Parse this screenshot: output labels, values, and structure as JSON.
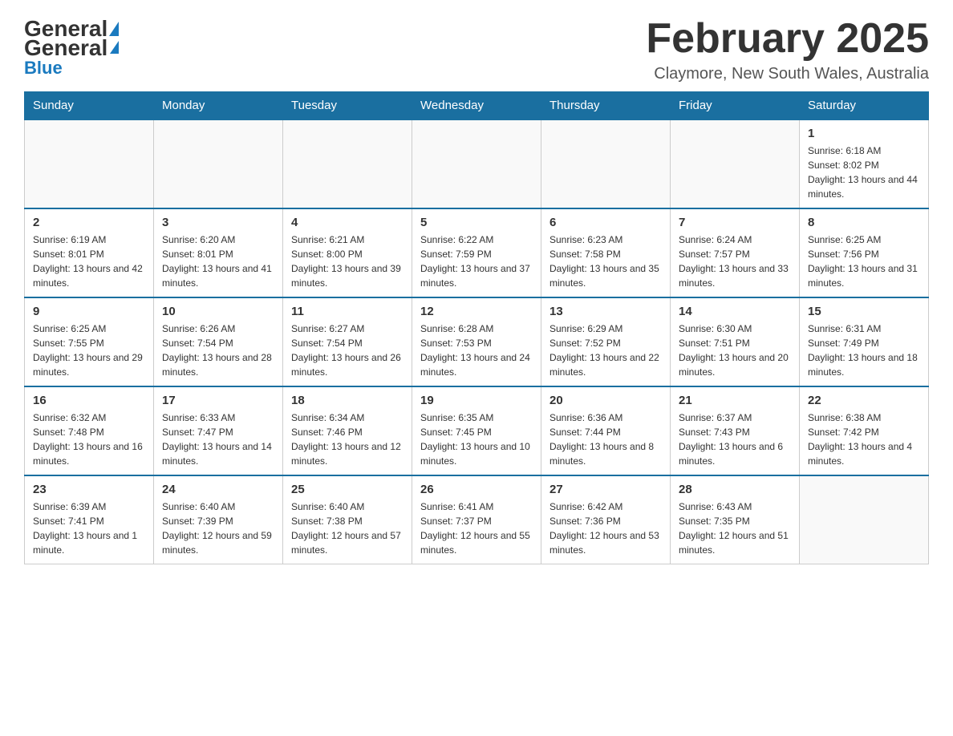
{
  "header": {
    "logo_general": "General",
    "logo_blue": "Blue",
    "month_title": "February 2025",
    "location": "Claymore, New South Wales, Australia"
  },
  "days_of_week": [
    "Sunday",
    "Monday",
    "Tuesday",
    "Wednesday",
    "Thursday",
    "Friday",
    "Saturday"
  ],
  "weeks": [
    [
      {
        "day": "",
        "info": ""
      },
      {
        "day": "",
        "info": ""
      },
      {
        "day": "",
        "info": ""
      },
      {
        "day": "",
        "info": ""
      },
      {
        "day": "",
        "info": ""
      },
      {
        "day": "",
        "info": ""
      },
      {
        "day": "1",
        "info": "Sunrise: 6:18 AM\nSunset: 8:02 PM\nDaylight: 13 hours and 44 minutes."
      }
    ],
    [
      {
        "day": "2",
        "info": "Sunrise: 6:19 AM\nSunset: 8:01 PM\nDaylight: 13 hours and 42 minutes."
      },
      {
        "day": "3",
        "info": "Sunrise: 6:20 AM\nSunset: 8:01 PM\nDaylight: 13 hours and 41 minutes."
      },
      {
        "day": "4",
        "info": "Sunrise: 6:21 AM\nSunset: 8:00 PM\nDaylight: 13 hours and 39 minutes."
      },
      {
        "day": "5",
        "info": "Sunrise: 6:22 AM\nSunset: 7:59 PM\nDaylight: 13 hours and 37 minutes."
      },
      {
        "day": "6",
        "info": "Sunrise: 6:23 AM\nSunset: 7:58 PM\nDaylight: 13 hours and 35 minutes."
      },
      {
        "day": "7",
        "info": "Sunrise: 6:24 AM\nSunset: 7:57 PM\nDaylight: 13 hours and 33 minutes."
      },
      {
        "day": "8",
        "info": "Sunrise: 6:25 AM\nSunset: 7:56 PM\nDaylight: 13 hours and 31 minutes."
      }
    ],
    [
      {
        "day": "9",
        "info": "Sunrise: 6:25 AM\nSunset: 7:55 PM\nDaylight: 13 hours and 29 minutes."
      },
      {
        "day": "10",
        "info": "Sunrise: 6:26 AM\nSunset: 7:54 PM\nDaylight: 13 hours and 28 minutes."
      },
      {
        "day": "11",
        "info": "Sunrise: 6:27 AM\nSunset: 7:54 PM\nDaylight: 13 hours and 26 minutes."
      },
      {
        "day": "12",
        "info": "Sunrise: 6:28 AM\nSunset: 7:53 PM\nDaylight: 13 hours and 24 minutes."
      },
      {
        "day": "13",
        "info": "Sunrise: 6:29 AM\nSunset: 7:52 PM\nDaylight: 13 hours and 22 minutes."
      },
      {
        "day": "14",
        "info": "Sunrise: 6:30 AM\nSunset: 7:51 PM\nDaylight: 13 hours and 20 minutes."
      },
      {
        "day": "15",
        "info": "Sunrise: 6:31 AM\nSunset: 7:49 PM\nDaylight: 13 hours and 18 minutes."
      }
    ],
    [
      {
        "day": "16",
        "info": "Sunrise: 6:32 AM\nSunset: 7:48 PM\nDaylight: 13 hours and 16 minutes."
      },
      {
        "day": "17",
        "info": "Sunrise: 6:33 AM\nSunset: 7:47 PM\nDaylight: 13 hours and 14 minutes."
      },
      {
        "day": "18",
        "info": "Sunrise: 6:34 AM\nSunset: 7:46 PM\nDaylight: 13 hours and 12 minutes."
      },
      {
        "day": "19",
        "info": "Sunrise: 6:35 AM\nSunset: 7:45 PM\nDaylight: 13 hours and 10 minutes."
      },
      {
        "day": "20",
        "info": "Sunrise: 6:36 AM\nSunset: 7:44 PM\nDaylight: 13 hours and 8 minutes."
      },
      {
        "day": "21",
        "info": "Sunrise: 6:37 AM\nSunset: 7:43 PM\nDaylight: 13 hours and 6 minutes."
      },
      {
        "day": "22",
        "info": "Sunrise: 6:38 AM\nSunset: 7:42 PM\nDaylight: 13 hours and 4 minutes."
      }
    ],
    [
      {
        "day": "23",
        "info": "Sunrise: 6:39 AM\nSunset: 7:41 PM\nDaylight: 13 hours and 1 minute."
      },
      {
        "day": "24",
        "info": "Sunrise: 6:40 AM\nSunset: 7:39 PM\nDaylight: 12 hours and 59 minutes."
      },
      {
        "day": "25",
        "info": "Sunrise: 6:40 AM\nSunset: 7:38 PM\nDaylight: 12 hours and 57 minutes."
      },
      {
        "day": "26",
        "info": "Sunrise: 6:41 AM\nSunset: 7:37 PM\nDaylight: 12 hours and 55 minutes."
      },
      {
        "day": "27",
        "info": "Sunrise: 6:42 AM\nSunset: 7:36 PM\nDaylight: 12 hours and 53 minutes."
      },
      {
        "day": "28",
        "info": "Sunrise: 6:43 AM\nSunset: 7:35 PM\nDaylight: 12 hours and 51 minutes."
      },
      {
        "day": "",
        "info": ""
      }
    ]
  ]
}
